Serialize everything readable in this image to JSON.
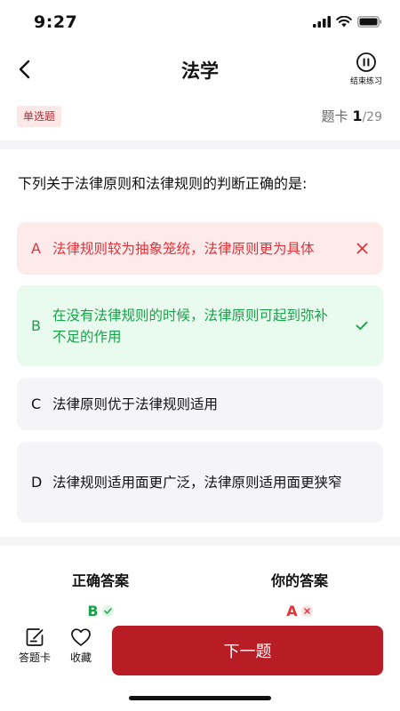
{
  "status": {
    "time": "9:27"
  },
  "nav": {
    "title": "法学",
    "end_label": "结束练习"
  },
  "question": {
    "type": "单选题",
    "counter_prefix": "题卡",
    "current": "1",
    "total": "/29",
    "text": "下列关于法律原则和法律规则的判断正确的是:",
    "options": [
      {
        "letter": "A",
        "text": "法律规则较为抽象笼统，法律原则更为具体",
        "state": "wrong"
      },
      {
        "letter": "B",
        "text": "在没有法律规则的时候，法律原则可起到弥补不足的作用",
        "state": "correct"
      },
      {
        "letter": "C",
        "text": "法律原则优于法律规则适用",
        "state": "normal"
      },
      {
        "letter": "D",
        "text": "法律规则适用面更广泛，法律原则适用面更狭窄",
        "state": "normal"
      }
    ]
  },
  "answers": {
    "correct_label": "正确答案",
    "correct_value": "B",
    "mine_label": "你的答案",
    "mine_value": "A"
  },
  "bottom": {
    "card_label": "答题卡",
    "fav_label": "收藏",
    "next_label": "下一题"
  },
  "colors": {
    "accent": "#b81c25",
    "correct": "#1aa24a",
    "wrong": "#e1333a"
  }
}
